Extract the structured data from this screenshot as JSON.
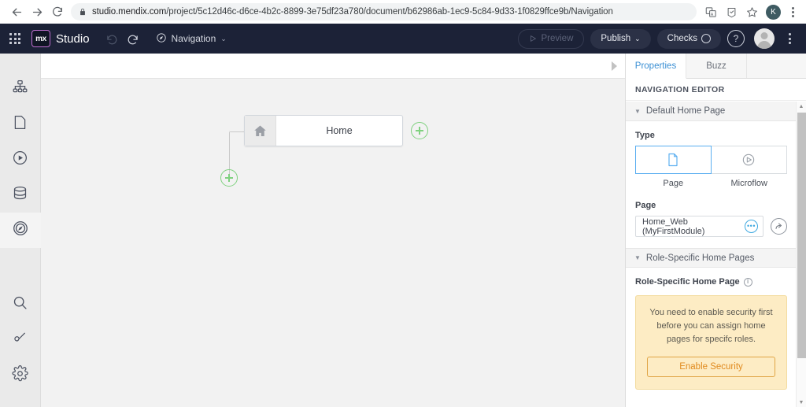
{
  "browser": {
    "back_icon": "back-arrow-icon",
    "forward_icon": "forward-arrow-icon",
    "reload_icon": "reload-icon",
    "lock_icon": "lock-icon",
    "url_domain": "studio.mendix.com",
    "url_path": "/project/5c12d46c-d6ce-4b2c-8899-3e75df23a780/document/b62986ab-1ec9-5c84-9d33-1f0829ffce9b/Navigation",
    "translate_icon": "translate-icon",
    "extensions_icon": "extensions-icon",
    "bookmark_icon": "star-icon",
    "profile_initial": "K",
    "menu_icon": "kebab-menu-icon"
  },
  "header": {
    "apps_icon": "grid-apps-icon",
    "logo_text": "mx",
    "product_name": "Studio",
    "undo_icon": "undo-icon",
    "redo_icon": "redo-icon",
    "document_icon": "compass-navigation-icon",
    "document_name": "Navigation",
    "document_caret": "⌄",
    "preview_label": "Preview",
    "preview_icon": "play-icon",
    "publish_label": "Publish",
    "publish_caret": "⌄",
    "checks_label": "Checks",
    "checks_icon": "circle-status-icon",
    "help_label": "?",
    "avatar": "user-avatar",
    "overflow_icon": "kebab-menu-icon"
  },
  "sidebar": {
    "items": [
      {
        "name": "sidebar-item-page-structure",
        "icon": "sitemap-icon",
        "active": false
      },
      {
        "name": "sidebar-item-pages",
        "icon": "page-icon",
        "active": false
      },
      {
        "name": "sidebar-item-microflows",
        "icon": "play-circle-icon",
        "active": false
      },
      {
        "name": "sidebar-item-domain-model",
        "icon": "database-icon",
        "active": false
      },
      {
        "name": "sidebar-item-navigation",
        "icon": "compass-icon",
        "active": true
      }
    ],
    "bottom_items": [
      {
        "name": "sidebar-item-search",
        "icon": "search-icon"
      },
      {
        "name": "sidebar-item-theme",
        "icon": "brush-icon"
      },
      {
        "name": "sidebar-item-settings",
        "icon": "gear-icon"
      }
    ]
  },
  "canvas": {
    "collapse_handle_icon": "triangle-right-icon",
    "node": {
      "icon": "home-icon",
      "label": "Home"
    },
    "add_item_right": "plus-circle-icon",
    "add_item_below": "plus-circle-icon",
    "accent_green": "#7fd17f"
  },
  "properties": {
    "tabs": [
      {
        "label": "Properties",
        "active": true
      },
      {
        "label": "Buzz",
        "active": false
      }
    ],
    "panel_title": "NAVIGATION EDITOR",
    "sections": [
      {
        "label": "Default Home Page",
        "collapsed": false
      },
      {
        "label": "Role-Specific Home Pages",
        "collapsed": false
      }
    ],
    "type": {
      "label": "Type",
      "options": [
        {
          "label": "Page",
          "icon": "page-icon",
          "selected": true
        },
        {
          "label": "Microflow",
          "icon": "play-circle-icon",
          "selected": false
        }
      ]
    },
    "page": {
      "label": "Page",
      "value": "Home_Web (MyFirstModule)",
      "select_icon": "ellipsis-circle-icon",
      "goto_icon": "open-arrow-circle-icon"
    },
    "role_specific": {
      "label": "Role-Specific Home Page",
      "info_icon": "info-icon",
      "warning_text": "You need to enable security first before you can assign home pages for specifc roles.",
      "button_label": "Enable Security"
    },
    "accent_blue": "#3a8fd4",
    "warning_bg": "#fdecc4"
  }
}
